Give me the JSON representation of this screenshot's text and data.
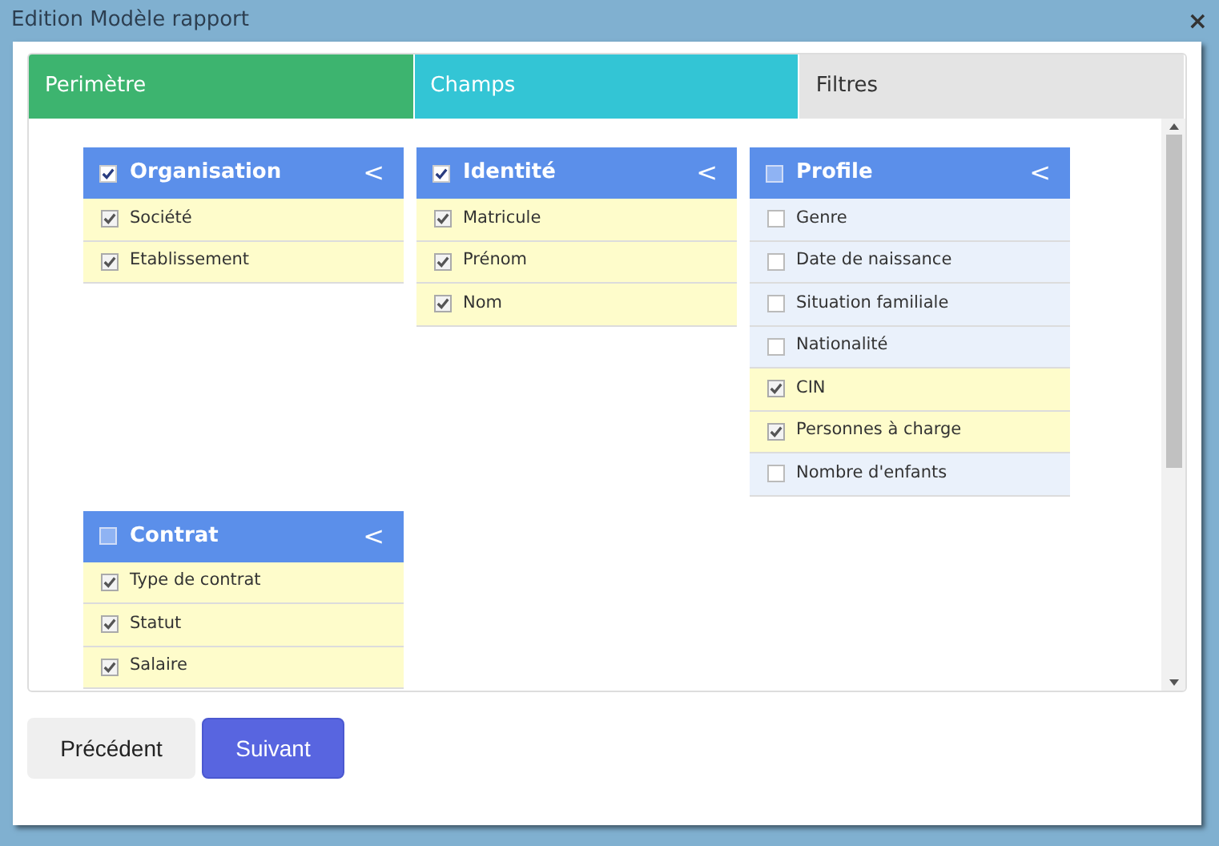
{
  "window": {
    "title": "Edition Modèle rapport",
    "close": "×"
  },
  "tabs": [
    {
      "label": "Perimètre",
      "selected": false
    },
    {
      "label": "Champs",
      "selected": true
    },
    {
      "label": "Filtres",
      "selected": false
    }
  ],
  "groups": [
    {
      "title": "Organisation",
      "checked": true,
      "toggle": "<",
      "fields": [
        {
          "label": "Société",
          "checked": true
        },
        {
          "label": "Etablissement",
          "checked": true
        }
      ]
    },
    {
      "title": "Identité",
      "checked": true,
      "toggle": "<",
      "fields": [
        {
          "label": "Matricule",
          "checked": true
        },
        {
          "label": "Prénom",
          "checked": true
        },
        {
          "label": "Nom",
          "checked": true
        }
      ]
    },
    {
      "title": "Profile",
      "checked": false,
      "toggle": "<",
      "fields": [
        {
          "label": "Genre",
          "checked": false
        },
        {
          "label": "Date de naissance",
          "checked": false
        },
        {
          "label": "Situation familiale",
          "checked": false
        },
        {
          "label": "Nationalité",
          "checked": false
        },
        {
          "label": "CIN",
          "checked": true
        },
        {
          "label": "Personnes à charge",
          "checked": true
        },
        {
          "label": "Nombre d'enfants",
          "checked": false
        }
      ]
    },
    {
      "title": "Contrat",
      "checked": false,
      "toggle": "<",
      "fields": [
        {
          "label": "Type de contrat",
          "checked": true
        },
        {
          "label": "Statut",
          "checked": true
        },
        {
          "label": "Salaire",
          "checked": true
        }
      ]
    }
  ],
  "buttons": [
    {
      "label": "Précédent",
      "kind": "secondary"
    },
    {
      "label": "Suivant",
      "kind": "primary"
    }
  ]
}
